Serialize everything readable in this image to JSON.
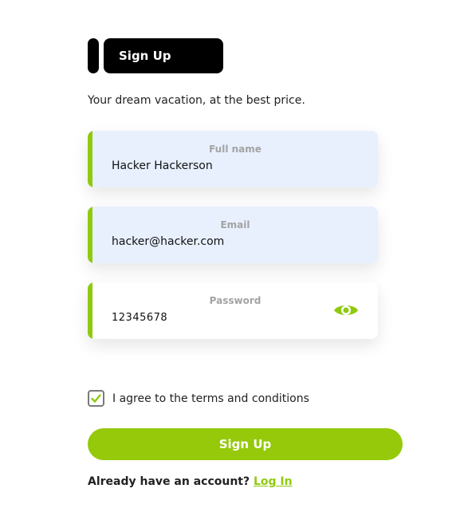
{
  "header": {
    "title": "Sign Up"
  },
  "tagline": "Your dream vacation, at the best price.",
  "form": {
    "full_name": {
      "label": "Full name",
      "value": "Hacker Hackerson"
    },
    "email": {
      "label": "Email",
      "value": "hacker@hacker.com"
    },
    "password": {
      "label": "Password",
      "value": "12345678",
      "toggle_icon": "eye-icon"
    },
    "terms": {
      "checked": true,
      "label": "I agree to the terms and conditions"
    },
    "submit_label": "Sign Up"
  },
  "footer": {
    "prompt": "Already have an account?",
    "link_label": "Log In"
  },
  "colors": {
    "accent": "#8fca0e",
    "button": "#95c90a",
    "autofill_bg": "#e8f0fe",
    "header_bg": "#000000"
  }
}
